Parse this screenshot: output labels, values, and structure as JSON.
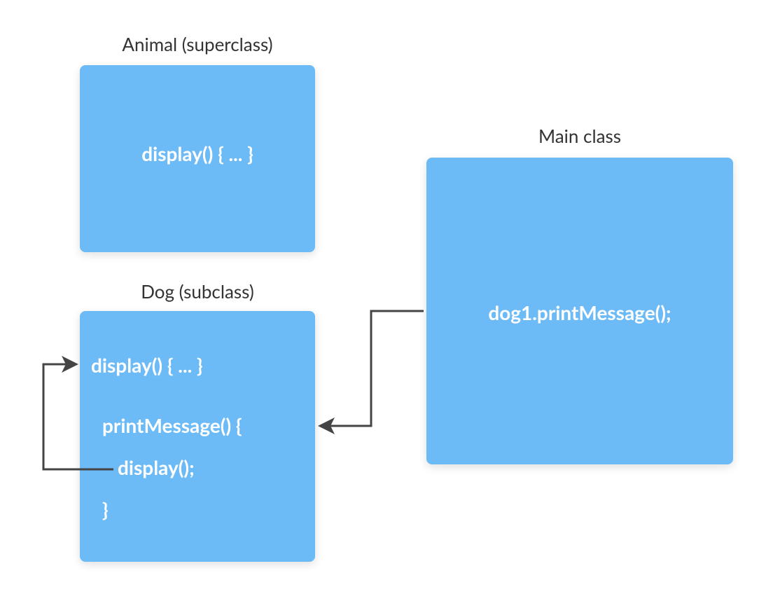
{
  "diagram": {
    "animal": {
      "label": "Animal (superclass)",
      "code": {
        "display": "display() { ... }"
      }
    },
    "dog": {
      "label": "Dog (subclass)",
      "code": {
        "display": "display() { ... }",
        "printMessageOpen": "printMessage() {",
        "displayCall": "display();",
        "close": "}"
      }
    },
    "main": {
      "label": "Main class",
      "code": {
        "call": "dog1.printMessage();"
      }
    }
  }
}
